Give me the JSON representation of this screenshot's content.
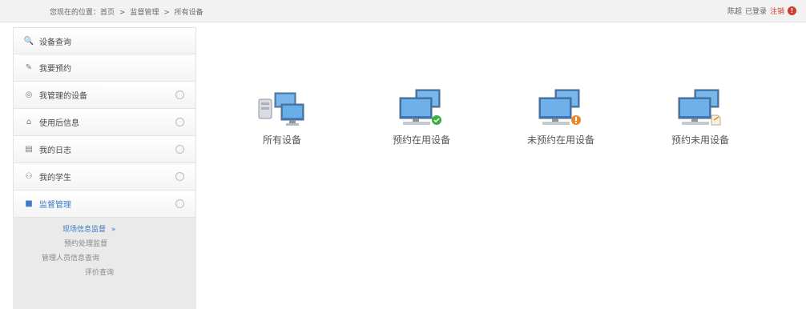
{
  "breadcrumb": {
    "items": [
      "您现在的位置：首页",
      "监督管理",
      "所有设备"
    ],
    "separator": ">"
  },
  "user": {
    "name": "陈超",
    "status": "已登录",
    "logout": "注销",
    "alert_icon": "!"
  },
  "sidebar": {
    "items": [
      {
        "label": "设备查询",
        "icon": "search-icon",
        "glyph": "🔍"
      },
      {
        "label": "我要预约",
        "icon": "pencil-icon",
        "glyph": "✎"
      },
      {
        "label": "我管理的设备",
        "icon": "eye-icon",
        "glyph": "◎"
      },
      {
        "label": "使用后信息",
        "icon": "bank-icon",
        "glyph": "⌂"
      },
      {
        "label": "我的日志",
        "icon": "log-icon",
        "glyph": "▤"
      },
      {
        "label": "我的学生",
        "icon": "users-icon",
        "glyph": "⚇"
      },
      {
        "label": "监督管理",
        "icon": "camera-icon",
        "glyph": "■"
      }
    ],
    "submenu": [
      {
        "label": "现场信息监督",
        "current": true,
        "arrow": "»"
      },
      {
        "label": "预约处理监督",
        "current": false
      },
      {
        "label": "管理人员信息查询",
        "current": false
      },
      {
        "label": "评价查询",
        "current": false
      }
    ]
  },
  "devices": [
    {
      "label": "所有设备",
      "icon": "all-devices-icon"
    },
    {
      "label": "预约在用设备",
      "icon": "reserved-in-use-icon",
      "badge_color": "#3cb043"
    },
    {
      "label": "未预约在用设备",
      "icon": "unreserved-in-use-icon",
      "badge_color": "#e8892c"
    },
    {
      "label": "预约未用设备",
      "icon": "reserved-unused-icon",
      "badge_color": "#f5f0e0"
    }
  ],
  "colors": {
    "accent": "#3d7bc6",
    "danger": "#d23b2e"
  }
}
